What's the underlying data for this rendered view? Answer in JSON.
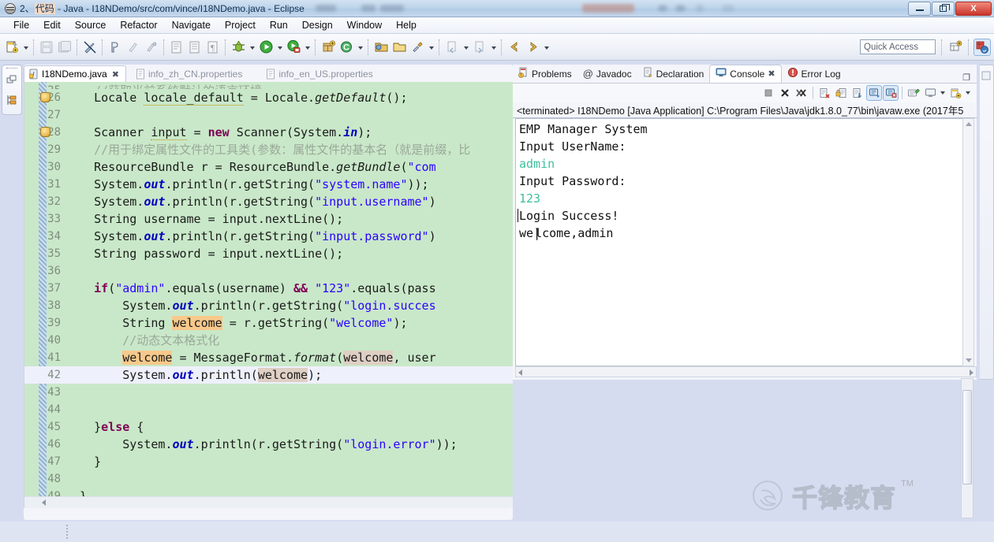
{
  "window": {
    "title_prefix": "2、",
    "title_zh": "代码",
    "title_rest": " - Java - I18NDemo/src/com/vince/I18NDemo.java - Eclipse",
    "minimize_label": "Minimize",
    "maximize_label": "Restore",
    "close_label": "X"
  },
  "menu": {
    "items": [
      "File",
      "Edit",
      "Source",
      "Refactor",
      "Navigate",
      "Project",
      "Run",
      "Design",
      "Window",
      "Help"
    ]
  },
  "toolbar": {
    "quick_access": "Quick Access",
    "icons": [
      "new-wizard-icon",
      "save-icon",
      "save-all-icon",
      "no-quick-fix-icon",
      "toggle-mark-occurrences-icon",
      "skip-breakpoints-icon",
      "next-annotation-icon",
      "open-task-icon",
      "print-icon",
      "paragraph-icon",
      "debug-icon",
      "run-icon",
      "run-coverage-icon",
      "new-java-package-icon",
      "new-class-icon",
      "open-type-icon",
      "open-resource-icon",
      "search-icon",
      "previous-edit-icon",
      "next-edit-icon",
      "back-icon",
      "forward-icon"
    ],
    "right_icons": [
      "new-java-project-icon",
      "java-perspective-icon"
    ]
  },
  "fastview": {
    "icons": [
      "restore-view-icon",
      "outline-view-icon"
    ]
  },
  "editor": {
    "tabs": [
      {
        "label": "I18NDemo.java",
        "icon": "java-file-icon",
        "active": true,
        "close": "✖"
      },
      {
        "label": "info_zh_CN.properties",
        "icon": "properties-file-icon",
        "active": false
      },
      {
        "label": "info_en_US.properties",
        "icon": "properties-file-icon",
        "active": false
      }
    ],
    "first_visible_line": 25,
    "current_line": 42,
    "warning_lines": [
      26,
      28
    ],
    "lines": [
      {
        "n": 25,
        "text": "    //获取当前系统默认的语言环境",
        "partial": true
      },
      {
        "n": 26,
        "text": "Locale locale_default = Locale.getDefault();"
      },
      {
        "n": 27,
        "text": ""
      },
      {
        "n": 28,
        "text": "Scanner input = new Scanner(System.in);"
      },
      {
        "n": 29,
        "text": "//用于绑定属性文件的工具类(参数：属性文件的基本名（就是前缀，比..."
      },
      {
        "n": 30,
        "text": "ResourceBundle r = ResourceBundle.getBundle(\"com"
      },
      {
        "n": 31,
        "text": "System.out.println(r.getString(\"system.name\"));"
      },
      {
        "n": 32,
        "text": "System.out.println(r.getString(\"input.username\")"
      },
      {
        "n": 33,
        "text": "String username = input.nextLine();"
      },
      {
        "n": 34,
        "text": "System.out.println(r.getString(\"input.password\")"
      },
      {
        "n": 35,
        "text": "String password = input.nextLine();"
      },
      {
        "n": 36,
        "text": ""
      },
      {
        "n": 37,
        "text": "if(\"admin\".equals(username) && \"123\".equals(pass"
      },
      {
        "n": 38,
        "text": "    System.out.println(r.getString(\"login.succes"
      },
      {
        "n": 39,
        "text": "    String welcome = r.getString(\"welcome\");"
      },
      {
        "n": 40,
        "text": "    //动态文本格式化"
      },
      {
        "n": 41,
        "text": "    welcome = MessageFormat.format(welcome, user"
      },
      {
        "n": 42,
        "text": "    System.out.println(welcome);"
      },
      {
        "n": 43,
        "text": ""
      },
      {
        "n": 44,
        "text": ""
      },
      {
        "n": 45,
        "text": "}else {"
      },
      {
        "n": 46,
        "text": "    System.out.println(r.getString(\"login.error\"));"
      },
      {
        "n": 47,
        "text": "}"
      },
      {
        "n": 48,
        "text": ""
      },
      {
        "n": 49,
        "text": "}"
      }
    ]
  },
  "views": {
    "tabs": [
      {
        "label": "Problems",
        "icon": "problems-icon",
        "active": false
      },
      {
        "label": "Javadoc",
        "icon": "javadoc-icon",
        "active": false
      },
      {
        "label": "Declaration",
        "icon": "declaration-icon",
        "active": false
      },
      {
        "label": "Console",
        "icon": "console-icon",
        "active": true,
        "close": "✖"
      },
      {
        "label": "Error Log",
        "icon": "error-log-icon",
        "active": false
      }
    ],
    "minimize_label": "❐"
  },
  "console": {
    "toolbar_icons": [
      "terminate-icon",
      "remove-launch-icon",
      "remove-all-terminated-icon",
      "clear-console-icon",
      "scroll-lock-icon",
      "word-wrap-icon",
      "show-console-on-output-icon",
      "pin-console-icon",
      "display-selected-console-icon",
      "open-console-icon"
    ],
    "header": "<terminated> I18NDemo [Java Application] C:\\Program Files\\Java\\jdk1.8.0_77\\bin\\javaw.exe (2017年5",
    "output": [
      {
        "text": "EMP Manager System",
        "kind": "out"
      },
      {
        "text": "Input UserName:",
        "kind": "out"
      },
      {
        "text": "admin",
        "kind": "in"
      },
      {
        "text": "Input Password:",
        "kind": "out"
      },
      {
        "text": "123",
        "kind": "in"
      },
      {
        "text": "Login Success!",
        "kind": "out"
      },
      {
        "text": "welcome,admin",
        "kind": "out"
      }
    ]
  },
  "watermark": {
    "brand": "千锋教育",
    "tm": "TM",
    "url": "https://blog.csdn.net/C_time"
  },
  "colors": {
    "editor_background": "#c9e8c9",
    "keyword": "#7f0055",
    "string": "#2a00ff",
    "comment": "#9aa89a",
    "field": "#0000c0",
    "console_input": "#3fbf9b",
    "accent": "#3b78c3"
  }
}
